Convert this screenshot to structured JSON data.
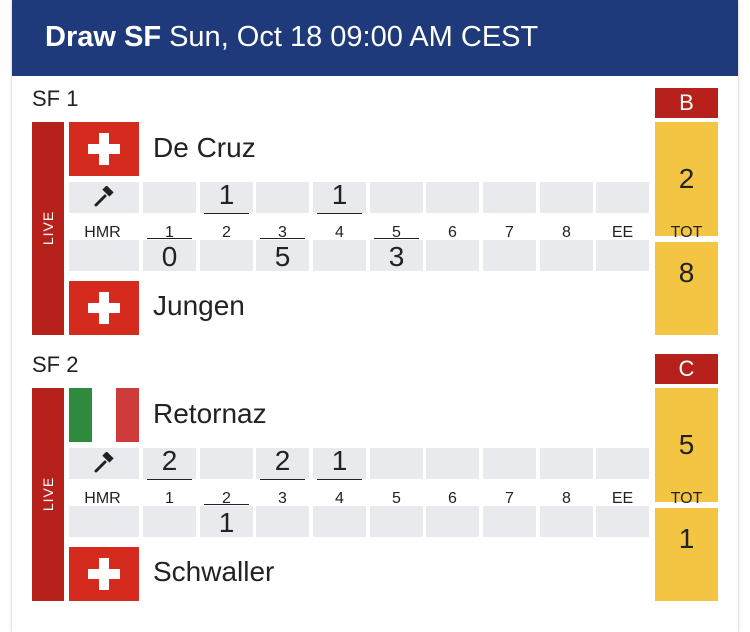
{
  "header": {
    "title_bold": "Draw SF",
    "title_rest": " Sun, Oct 18 09:00 AM CEST"
  },
  "games": [
    {
      "label": "SF 1",
      "sheet": "B",
      "live": "LIVE",
      "hmr_label": "HMR",
      "tot_label": "TOT",
      "end_labels": [
        "1",
        "2",
        "3",
        "4",
        "5",
        "6",
        "7",
        "8",
        "EE"
      ],
      "team1": {
        "name": "De Cruz",
        "flag": "switzerland",
        "total": "2",
        "hammer": true,
        "ends": [
          "",
          "1",
          "",
          "1",
          "",
          "",
          "",
          "",
          ""
        ]
      },
      "team2": {
        "name": "Jungen",
        "flag": "switzerland",
        "total": "8",
        "hammer": false,
        "ends": [
          "0",
          "",
          "5",
          "",
          "3",
          "",
          "",
          "",
          ""
        ]
      },
      "underlined_ends": [
        0,
        1,
        2,
        3,
        4
      ]
    },
    {
      "label": "SF 2",
      "sheet": "C",
      "live": "LIVE",
      "hmr_label": "HMR",
      "tot_label": "TOT",
      "end_labels": [
        "1",
        "2",
        "3",
        "4",
        "5",
        "6",
        "7",
        "8",
        "EE"
      ],
      "team1": {
        "name": "Retornaz",
        "flag": "italy",
        "total": "5",
        "hammer": true,
        "ends": [
          "2",
          "",
          "2",
          "1",
          "",
          "",
          "",
          "",
          ""
        ]
      },
      "team2": {
        "name": "Schwaller",
        "flag": "switzerland",
        "total": "1",
        "hammer": false,
        "ends": [
          "",
          "1",
          "",
          "",
          "",
          "",
          "",
          "",
          ""
        ]
      },
      "underlined_ends": [
        0,
        1,
        2,
        3
      ]
    }
  ],
  "colors": {
    "header_bg": "#1f3a7a",
    "live_red": "#b7211b",
    "score_yellow": "#f4c542",
    "cell_gray": "#e8eaed",
    "italy_green": "#2e8b3e",
    "italy_white": "#ffffff",
    "italy_red": "#ce3b3b",
    "swiss_red": "#d52b1e"
  },
  "icons": {
    "hammer": "hammer-icon",
    "swiss_flag": "switzerland-flag-icon",
    "italy_flag": "italy-flag-icon"
  }
}
